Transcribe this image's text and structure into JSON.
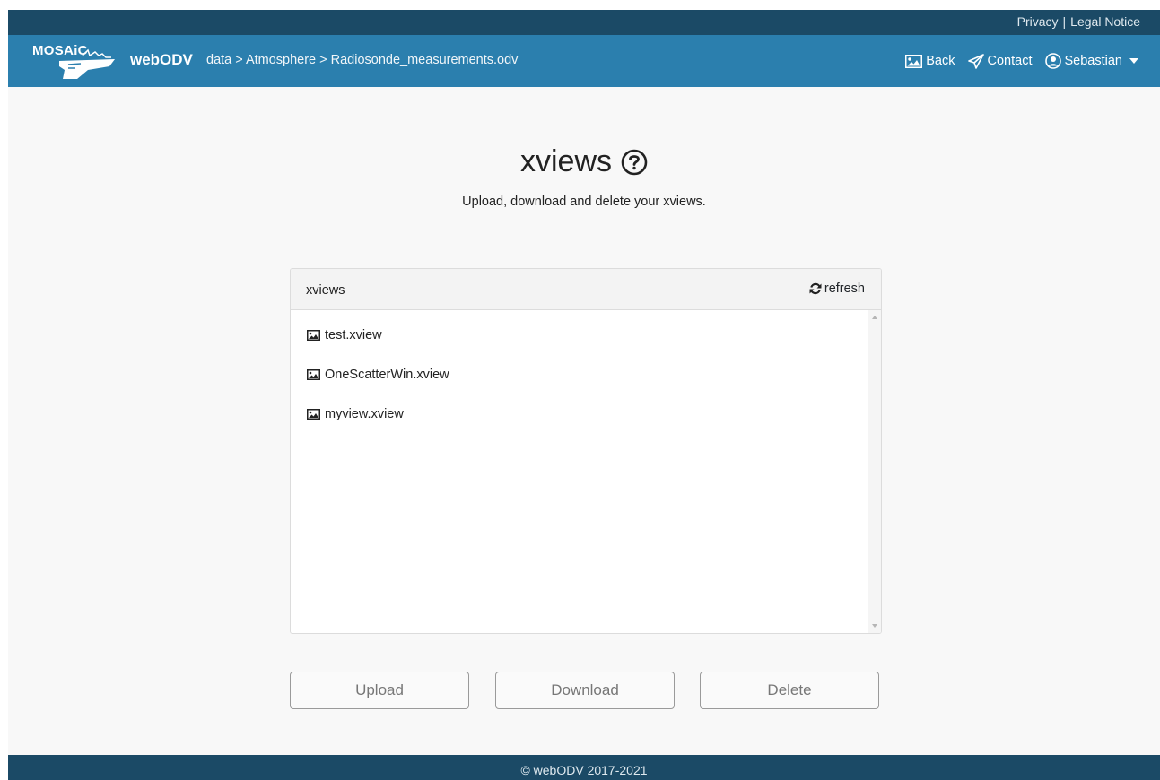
{
  "top_links": {
    "privacy": "Privacy",
    "separator": "|",
    "legal": "Legal Notice"
  },
  "navbar": {
    "logo_text": "MOSAiC",
    "brand": "webODV",
    "breadcrumb": "data > Atmosphere > Radiosonde_measurements.odv",
    "back": "Back",
    "contact": "Contact",
    "user": "Sebastian"
  },
  "page": {
    "title": "xviews",
    "subtitle": "Upload, download and delete your xviews."
  },
  "panel": {
    "title": "xviews",
    "refresh": "refresh",
    "files": [
      "test.xview",
      "OneScatterWin.xview",
      "myview.xview"
    ]
  },
  "actions": {
    "upload": "Upload",
    "download": "Download",
    "delete": "Delete"
  },
  "footer": {
    "text": "© webODV 2017-2021"
  },
  "colors": {
    "topbar": "#1b4a66",
    "navbar": "#2b7fae",
    "background": "#f8f8f8"
  }
}
